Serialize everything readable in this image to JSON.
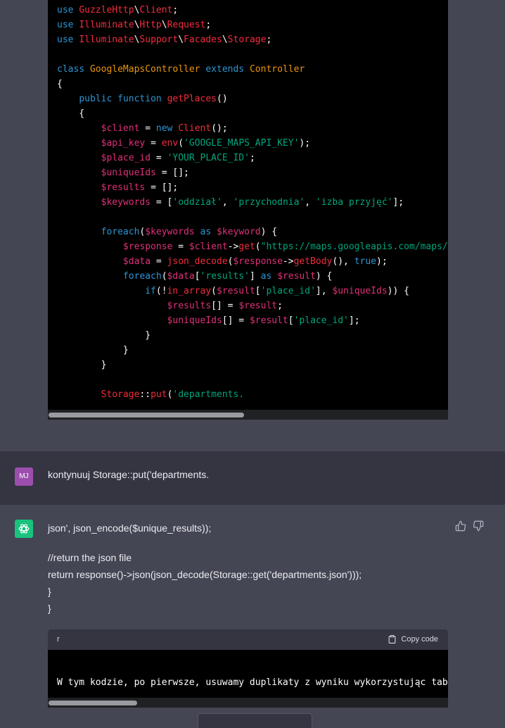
{
  "code_block_1": {
    "lines": [
      [
        {
          "t": "use ",
          "c": "kw"
        },
        {
          "t": "GuzzleHttp",
          "c": "cls"
        },
        {
          "t": "\\",
          "c": "plain"
        },
        {
          "t": "Client",
          "c": "cls"
        },
        {
          "t": ";",
          "c": "plain"
        }
      ],
      [
        {
          "t": "use ",
          "c": "kw"
        },
        {
          "t": "Illuminate",
          "c": "cls"
        },
        {
          "t": "\\",
          "c": "plain"
        },
        {
          "t": "Http",
          "c": "cls"
        },
        {
          "t": "\\",
          "c": "plain"
        },
        {
          "t": "Request",
          "c": "cls"
        },
        {
          "t": ";",
          "c": "plain"
        }
      ],
      [
        {
          "t": "use ",
          "c": "kw"
        },
        {
          "t": "Illuminate",
          "c": "cls"
        },
        {
          "t": "\\",
          "c": "plain"
        },
        {
          "t": "Support",
          "c": "cls"
        },
        {
          "t": "\\",
          "c": "plain"
        },
        {
          "t": "Facades",
          "c": "cls"
        },
        {
          "t": "\\",
          "c": "plain"
        },
        {
          "t": "Storage",
          "c": "cls"
        },
        {
          "t": ";",
          "c": "plain"
        }
      ],
      [],
      [
        {
          "t": "class ",
          "c": "kw"
        },
        {
          "t": "GoogleMapsController ",
          "c": "title"
        },
        {
          "t": "extends ",
          "c": "kw"
        },
        {
          "t": "Controller",
          "c": "title"
        }
      ],
      [
        {
          "t": "{",
          "c": "plain"
        }
      ],
      [
        {
          "t": "    ",
          "c": "plain"
        },
        {
          "t": "public ",
          "c": "kw"
        },
        {
          "t": "function ",
          "c": "kw"
        },
        {
          "t": "getPlaces",
          "c": "fn"
        },
        {
          "t": "()",
          "c": "plain"
        }
      ],
      [
        {
          "t": "    {",
          "c": "plain"
        }
      ],
      [
        {
          "t": "        ",
          "c": "plain"
        },
        {
          "t": "$client",
          "c": "var"
        },
        {
          "t": " = ",
          "c": "plain"
        },
        {
          "t": "new ",
          "c": "kw"
        },
        {
          "t": "Client",
          "c": "cls"
        },
        {
          "t": "();",
          "c": "plain"
        }
      ],
      [
        {
          "t": "        ",
          "c": "plain"
        },
        {
          "t": "$api_key",
          "c": "var"
        },
        {
          "t": " = ",
          "c": "plain"
        },
        {
          "t": "env",
          "c": "fn"
        },
        {
          "t": "(",
          "c": "plain"
        },
        {
          "t": "'GOOGLE_MAPS_API_KEY'",
          "c": "str"
        },
        {
          "t": ");",
          "c": "plain"
        }
      ],
      [
        {
          "t": "        ",
          "c": "plain"
        },
        {
          "t": "$place_id",
          "c": "var"
        },
        {
          "t": " = ",
          "c": "plain"
        },
        {
          "t": "'YOUR_PLACE_ID'",
          "c": "str"
        },
        {
          "t": ";",
          "c": "plain"
        }
      ],
      [
        {
          "t": "        ",
          "c": "plain"
        },
        {
          "t": "$uniqueIds",
          "c": "var"
        },
        {
          "t": " = [];",
          "c": "plain"
        }
      ],
      [
        {
          "t": "        ",
          "c": "plain"
        },
        {
          "t": "$results",
          "c": "var"
        },
        {
          "t": " = [];",
          "c": "plain"
        }
      ],
      [
        {
          "t": "        ",
          "c": "plain"
        },
        {
          "t": "$keywords",
          "c": "var"
        },
        {
          "t": " = [",
          "c": "plain"
        },
        {
          "t": "'oddział'",
          "c": "str"
        },
        {
          "t": ", ",
          "c": "plain"
        },
        {
          "t": "'przychodnia'",
          "c": "str"
        },
        {
          "t": ", ",
          "c": "plain"
        },
        {
          "t": "'izba przyjęć'",
          "c": "str"
        },
        {
          "t": "];",
          "c": "plain"
        }
      ],
      [],
      [
        {
          "t": "        ",
          "c": "plain"
        },
        {
          "t": "foreach",
          "c": "kw"
        },
        {
          "t": "(",
          "c": "plain"
        },
        {
          "t": "$keywords",
          "c": "var"
        },
        {
          "t": " as ",
          "c": "kw"
        },
        {
          "t": "$keyword",
          "c": "var"
        },
        {
          "t": ") {",
          "c": "plain"
        }
      ],
      [
        {
          "t": "            ",
          "c": "plain"
        },
        {
          "t": "$response",
          "c": "var"
        },
        {
          "t": " = ",
          "c": "plain"
        },
        {
          "t": "$client",
          "c": "var"
        },
        {
          "t": "->",
          "c": "plain"
        },
        {
          "t": "get",
          "c": "fn"
        },
        {
          "t": "(",
          "c": "plain"
        },
        {
          "t": "\"https://maps.googleapis.com/maps/api/place/textsearch/json\"",
          "c": "str"
        }
      ],
      [
        {
          "t": "            ",
          "c": "plain"
        },
        {
          "t": "$data",
          "c": "var"
        },
        {
          "t": " = ",
          "c": "plain"
        },
        {
          "t": "json_decode",
          "c": "fn"
        },
        {
          "t": "(",
          "c": "plain"
        },
        {
          "t": "$response",
          "c": "var"
        },
        {
          "t": "->",
          "c": "plain"
        },
        {
          "t": "getBody",
          "c": "fn"
        },
        {
          "t": "(), ",
          "c": "plain"
        },
        {
          "t": "true",
          "c": "kw"
        },
        {
          "t": ");",
          "c": "plain"
        }
      ],
      [
        {
          "t": "            ",
          "c": "plain"
        },
        {
          "t": "foreach",
          "c": "kw"
        },
        {
          "t": "(",
          "c": "plain"
        },
        {
          "t": "$data",
          "c": "var"
        },
        {
          "t": "[",
          "c": "plain"
        },
        {
          "t": "'results'",
          "c": "str"
        },
        {
          "t": "] ",
          "c": "plain"
        },
        {
          "t": "as ",
          "c": "kw"
        },
        {
          "t": "$result",
          "c": "var"
        },
        {
          "t": ") {",
          "c": "plain"
        }
      ],
      [
        {
          "t": "                ",
          "c": "plain"
        },
        {
          "t": "if",
          "c": "kw"
        },
        {
          "t": "(!",
          "c": "plain"
        },
        {
          "t": "in_array",
          "c": "fn"
        },
        {
          "t": "(",
          "c": "plain"
        },
        {
          "t": "$result",
          "c": "var"
        },
        {
          "t": "[",
          "c": "plain"
        },
        {
          "t": "'place_id'",
          "c": "str"
        },
        {
          "t": "], ",
          "c": "plain"
        },
        {
          "t": "$uniqueIds",
          "c": "var"
        },
        {
          "t": ")) {",
          "c": "plain"
        }
      ],
      [
        {
          "t": "                    ",
          "c": "plain"
        },
        {
          "t": "$results",
          "c": "var"
        },
        {
          "t": "[] = ",
          "c": "plain"
        },
        {
          "t": "$result",
          "c": "var"
        },
        {
          "t": ";",
          "c": "plain"
        }
      ],
      [
        {
          "t": "                    ",
          "c": "plain"
        },
        {
          "t": "$uniqueIds",
          "c": "var"
        },
        {
          "t": "[] = ",
          "c": "plain"
        },
        {
          "t": "$result",
          "c": "var"
        },
        {
          "t": "[",
          "c": "plain"
        },
        {
          "t": "'place_id'",
          "c": "str"
        },
        {
          "t": "];",
          "c": "plain"
        }
      ],
      [
        {
          "t": "                }",
          "c": "plain"
        }
      ],
      [
        {
          "t": "            }",
          "c": "plain"
        }
      ],
      [
        {
          "t": "        }",
          "c": "plain"
        }
      ],
      [],
      [
        {
          "t": "        ",
          "c": "plain"
        },
        {
          "t": "Storage",
          "c": "cls"
        },
        {
          "t": "::",
          "c": "plain"
        },
        {
          "t": "put",
          "c": "fn"
        },
        {
          "t": "(",
          "c": "plain"
        },
        {
          "t": "'departments.",
          "c": "str"
        }
      ]
    ]
  },
  "user_message": {
    "avatar_initials": "MJ",
    "text": "kontynuuj  Storage::put('departments."
  },
  "assistant_reply": {
    "lines": [
      "json', json_encode($unique_results));",
      "//return the json file",
      "return response()->json(json_decode(Storage::get('departments.json')));",
      "}",
      "}"
    ]
  },
  "code_block_2": {
    "language": "r",
    "copy_label": "Copy code",
    "line": [
      {
        "t": "W tym kodzie, po pierwsze, usuwamy duplikaty z wyniku wykorzystując tablicę",
        "c": "plain"
      }
    ]
  },
  "colors": {
    "kw": "#2e95d3",
    "cls": "#f22c3d",
    "title": "#e9950c",
    "fn": "#f22c3d",
    "var": "#df3079",
    "str": "#00a67d",
    "plain": "#ffffff"
  }
}
